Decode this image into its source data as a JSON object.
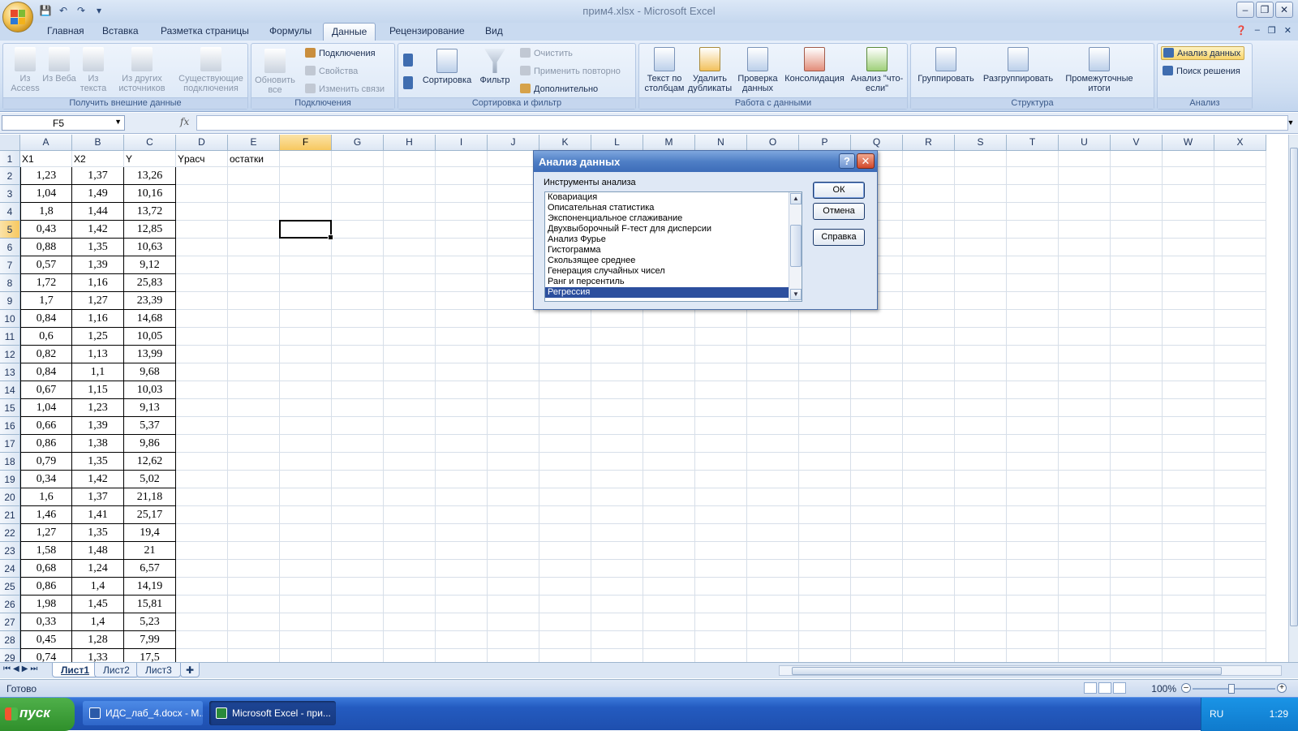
{
  "window": {
    "title": "прим4.xlsx - Microsoft Excel"
  },
  "ribbon_tabs": [
    "Главная",
    "Вставка",
    "Разметка страницы",
    "Формулы",
    "Данные",
    "Рецензирование",
    "Вид"
  ],
  "active_tab": "Данные",
  "ribbon": {
    "ext_data": {
      "caption": "Получить внешние данные",
      "access": "Из Access",
      "web": "Из Веба",
      "text": "Из текста",
      "other": "Из других источников",
      "existing": "Существующие подключения"
    },
    "connections": {
      "caption": "Подключения",
      "refresh": "Обновить все",
      "conn": "Подключения",
      "props": "Свойства",
      "edit": "Изменить связи"
    },
    "sort": {
      "caption": "Сортировка и фильтр",
      "sort": "Сортировка",
      "filter": "Фильтр",
      "clear": "Очистить",
      "reapply": "Применить повторно",
      "advanced": "Дополнительно"
    },
    "tools": {
      "caption": "Работа с данными",
      "t2c": "Текст по столбцам",
      "dup": "Удалить дубликаты",
      "valid": "Проверка данных",
      "consol": "Консолидация",
      "whatif": "Анализ \"что-если\""
    },
    "outline": {
      "caption": "Структура",
      "group": "Группировать",
      "ungroup": "Разгруппировать",
      "subtotal": "Промежуточные итоги"
    },
    "analysis": {
      "caption": "Анализ",
      "data_analysis": "Анализ данных",
      "solver": "Поиск решения"
    }
  },
  "formula_bar": {
    "name_box": "F5",
    "fx": "fx",
    "value": ""
  },
  "columns": [
    "A",
    "B",
    "C",
    "D",
    "E",
    "F",
    "G",
    "H",
    "I",
    "J",
    "K",
    "L",
    "M",
    "N",
    "O",
    "P",
    "Q",
    "R",
    "S",
    "T",
    "U",
    "V",
    "W",
    "X"
  ],
  "selected_column": "F",
  "selected_row": 5,
  "headers": {
    "A": "X1",
    "B": "X2",
    "C": "Y",
    "D": "Yрасч",
    "E": "остатки"
  },
  "rows": [
    [
      "1,23",
      "1,37",
      "13,26"
    ],
    [
      "1,04",
      "1,49",
      "10,16"
    ],
    [
      "1,8",
      "1,44",
      "13,72"
    ],
    [
      "0,43",
      "1,42",
      "12,85"
    ],
    [
      "0,88",
      "1,35",
      "10,63"
    ],
    [
      "0,57",
      "1,39",
      "9,12"
    ],
    [
      "1,72",
      "1,16",
      "25,83"
    ],
    [
      "1,7",
      "1,27",
      "23,39"
    ],
    [
      "0,84",
      "1,16",
      "14,68"
    ],
    [
      "0,6",
      "1,25",
      "10,05"
    ],
    [
      "0,82",
      "1,13",
      "13,99"
    ],
    [
      "0,84",
      "1,1",
      "9,68"
    ],
    [
      "0,67",
      "1,15",
      "10,03"
    ],
    [
      "1,04",
      "1,23",
      "9,13"
    ],
    [
      "0,66",
      "1,39",
      "5,37"
    ],
    [
      "0,86",
      "1,38",
      "9,86"
    ],
    [
      "0,79",
      "1,35",
      "12,62"
    ],
    [
      "0,34",
      "1,42",
      "5,02"
    ],
    [
      "1,6",
      "1,37",
      "21,18"
    ],
    [
      "1,46",
      "1,41",
      "25,17"
    ],
    [
      "1,27",
      "1,35",
      "19,4"
    ],
    [
      "1,58",
      "1,48",
      "21"
    ],
    [
      "0,68",
      "1,24",
      "6,57"
    ],
    [
      "0,86",
      "1,4",
      "14,19"
    ],
    [
      "1,98",
      "1,45",
      "15,81"
    ],
    [
      "0,33",
      "1,4",
      "5,23"
    ],
    [
      "0,45",
      "1,28",
      "7,99"
    ],
    [
      "0,74",
      "1,33",
      "17,5"
    ]
  ],
  "sheet_tabs": [
    "Лист1",
    "Лист2",
    "Лист3"
  ],
  "active_sheet": "Лист1",
  "status": {
    "text": "Готово",
    "zoom": "100%"
  },
  "dialog": {
    "title": "Анализ данных",
    "label": "Инструменты анализа",
    "items": [
      "Ковариация",
      "Описательная статистика",
      "Экспоненциальное сглаживание",
      "Двухвыборочный F-тест для дисперсии",
      "Анализ Фурье",
      "Гистограмма",
      "Скользящее среднее",
      "Генерация случайных чисел",
      "Ранг и персентиль",
      "Регрессия"
    ],
    "selected": "Регрессия",
    "ok": "ОК",
    "cancel": "Отмена",
    "help": "Справка"
  },
  "taskbar": {
    "start": "пуск",
    "tasks": [
      "ИДС_лаб_4.docx - M...",
      "Microsoft Excel - при..."
    ],
    "lang": "RU",
    "time": "1:29"
  }
}
